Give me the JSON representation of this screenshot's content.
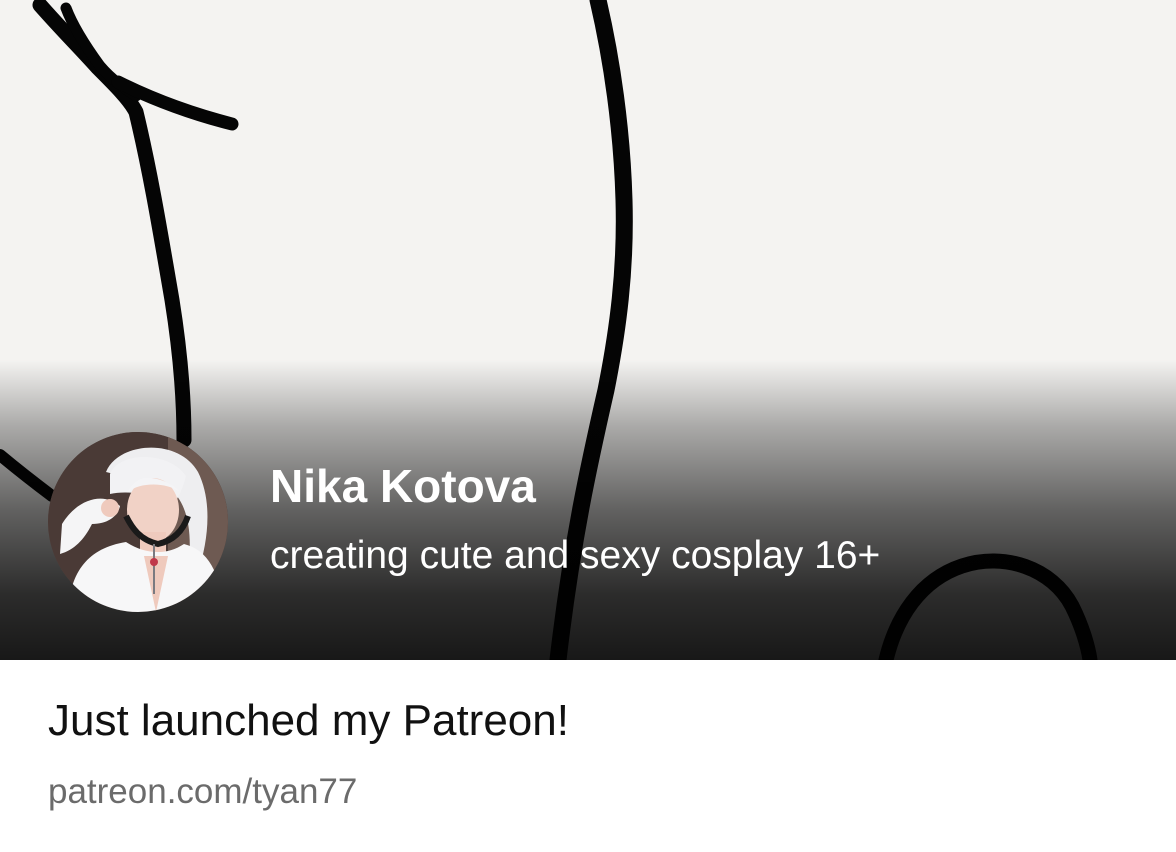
{
  "creator": {
    "name": "Nika Kotova",
    "tagline": "creating cute and sexy cosplay 16+"
  },
  "post": {
    "title": "Just launched my Patreon!",
    "link": "patreon.com/tyan77"
  },
  "colors": {
    "banner_background": "#f4f3f1",
    "scribble": "#050505",
    "header_text": "#ffffff",
    "title_text": "#111111",
    "link_text": "#6b6b6b"
  },
  "icons": {
    "avatar": "creator-profile-photo"
  }
}
